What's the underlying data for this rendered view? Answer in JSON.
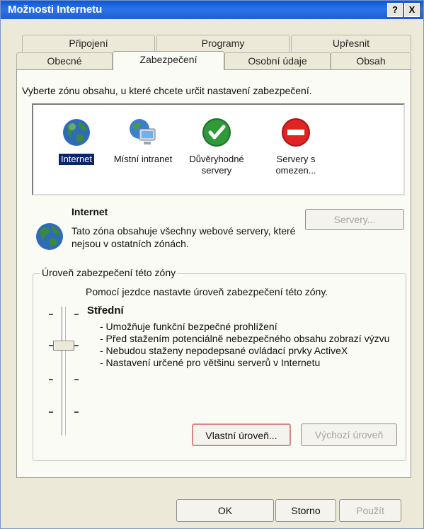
{
  "window": {
    "title": "Možnosti Internetu",
    "help_label": "?",
    "close_label": "X"
  },
  "tabs_back": [
    "Připojení",
    "Programy",
    "Upřesnit"
  ],
  "tabs_front": [
    "Obecné",
    "Zabezpečení",
    "Osobní údaje",
    "Obsah"
  ],
  "active_tab": "Zabezpečení",
  "zone_prompt": "Vyberte zónu obsahu, u které chcete určit nastavení zabezpečení.",
  "zones": [
    {
      "label": "Internet",
      "icon": "globe-icon",
      "selected": true
    },
    {
      "label": "Místní intranet",
      "icon": "computer-globe-icon",
      "selected": false
    },
    {
      "label": "Důvěryhodné servery",
      "icon": "green-check-icon",
      "selected": false
    },
    {
      "label": "Servery s omezen...",
      "icon": "red-stop-icon",
      "selected": false
    }
  ],
  "info": {
    "title": "Internet",
    "description": "Tato zóna obsahuje všechny webové servery, které nejsou v ostatních zónách.",
    "servers_button": "Servery..."
  },
  "security_level": {
    "group_label": "Úroveň zabezpečení této zóny",
    "help": "Pomocí jezdce nastavte úroveň zabezpečení této zóny.",
    "level_name": "Střední",
    "items": [
      "- Umožňuje funkční bezpečné prohlížení",
      "- Před stažením potenciálně nebezpečného obsahu zobrazí výzvu",
      "- Nebudou staženy nepodepsané ovládací prvky ActiveX",
      "- Nastavení určené pro většinu serverů v Internetu"
    ],
    "custom_button": "Vlastní úroveň...",
    "default_button": "Výchozí úroveň"
  },
  "footer": {
    "ok": "OK",
    "cancel": "Storno",
    "apply": "Použít"
  },
  "colors": {
    "titlebar": "#0a56d6",
    "selected_zone": "#0a246a",
    "custom_button_border": "#d68888"
  }
}
